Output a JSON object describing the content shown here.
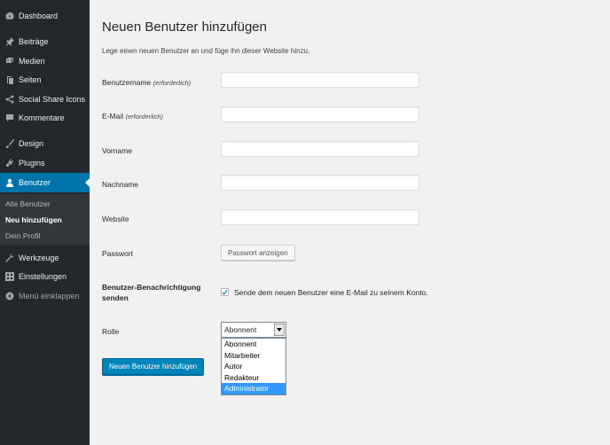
{
  "sidebar": {
    "items": [
      {
        "label": "Dashboard",
        "icon": "dashboard-icon"
      },
      {
        "label": "Beiträge",
        "icon": "pushpin-icon"
      },
      {
        "label": "Medien",
        "icon": "media-icon"
      },
      {
        "label": "Seiten",
        "icon": "pages-icon"
      },
      {
        "label": "Social Share Icons",
        "icon": "share-icon"
      },
      {
        "label": "Kommentare",
        "icon": "comment-icon"
      },
      {
        "label": "Design",
        "icon": "paintbrush-icon"
      },
      {
        "label": "Plugins",
        "icon": "plugin-icon"
      },
      {
        "label": "Benutzer",
        "icon": "user-icon"
      },
      {
        "label": "Werkzeuge",
        "icon": "wrench-icon"
      },
      {
        "label": "Einstellungen",
        "icon": "settings-icon"
      },
      {
        "label": "Menü einklappen",
        "icon": "collapse-icon"
      }
    ],
    "submenu": [
      {
        "label": "Alle Benutzer"
      },
      {
        "label": "Neu hinzufügen"
      },
      {
        "label": "Dein Profil"
      }
    ]
  },
  "main": {
    "title": "Neuen Benutzer hinzufügen",
    "intro": "Lege einen neuen Benutzer an und füge ihn dieser Website hinzu.",
    "fields": {
      "username": {
        "label": "Benutzername",
        "note": "(erforderlich)",
        "value": ""
      },
      "email": {
        "label": "E-Mail",
        "note": "(erforderlich)",
        "value": ""
      },
      "firstname": {
        "label": "Vorname",
        "value": ""
      },
      "lastname": {
        "label": "Nachname",
        "value": ""
      },
      "website": {
        "label": "Website",
        "value": ""
      }
    },
    "password": {
      "label": "Passwort",
      "button": "Passwort anzeigen"
    },
    "notification": {
      "label_line1": "Benutzer-Benachrichtigung",
      "label_line2": "senden",
      "checkbox_label": "Sende dem neuen Benutzer eine E-Mail zu seinem Konto.",
      "checked": true
    },
    "role": {
      "label": "Rolle",
      "selected": "Abonnent",
      "options": [
        "Abonnent",
        "Mitarbeiter",
        "Autor",
        "Redakteur",
        "Administrator"
      ],
      "highlighted": "Administrator"
    },
    "submit_label": "Neuen Benutzer hinzufügen"
  },
  "colors": {
    "sidebar_bg": "#23282d",
    "active_bg": "#0073aa",
    "primary_button": "#0085ba",
    "option_highlight": "#3399ff"
  }
}
